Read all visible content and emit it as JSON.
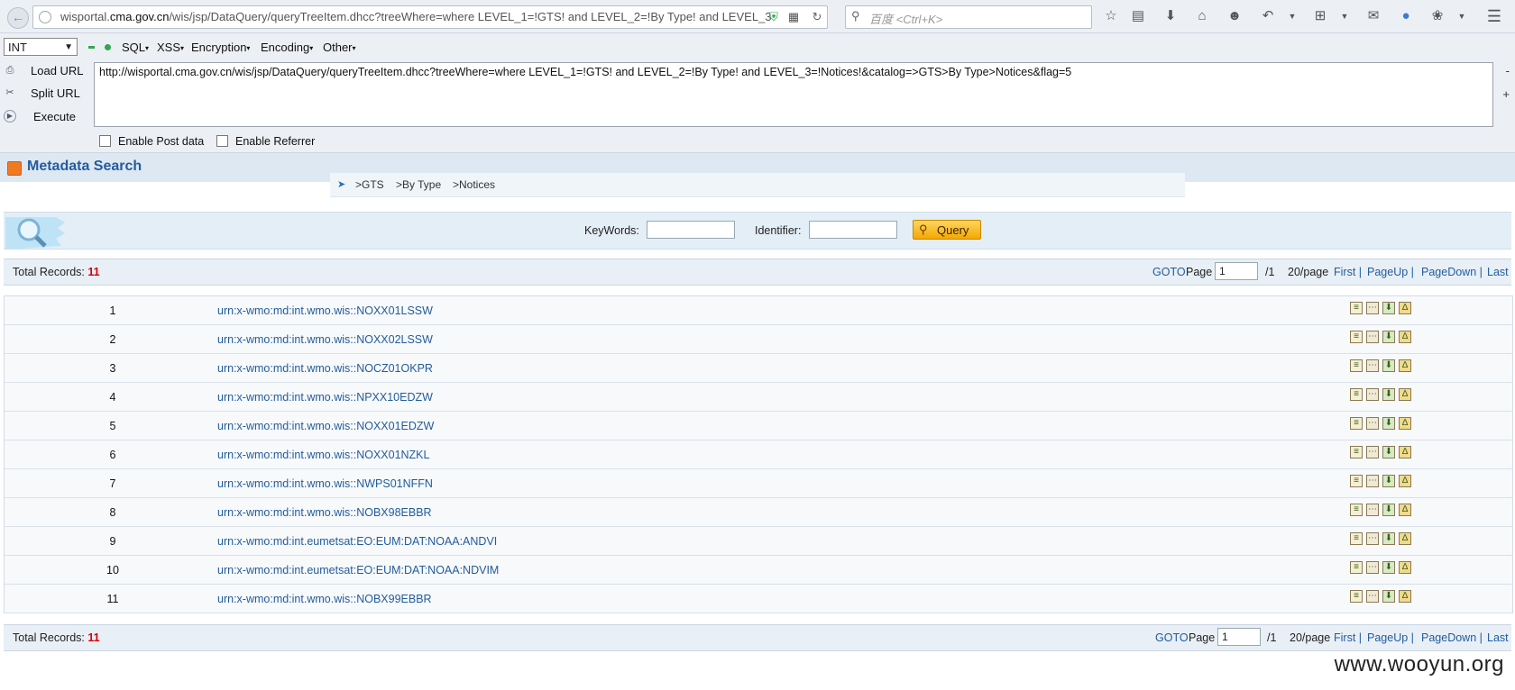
{
  "browser": {
    "url_host_prefix": "wisportal.",
    "url_host_main": "cma.gov.cn",
    "url_path": "/wis/jsp/DataQuery/queryTreeItem.dhcc?treeWhere=where LEVEL_1=!GTS! and LEVEL_2=!By Type! and LEVEL_3",
    "search_placeholder": "百度 <Ctrl+K>"
  },
  "hackbar": {
    "select_value": "INT",
    "menus": [
      "SQL",
      "XSS",
      "Encryption",
      "Encoding",
      "Other"
    ],
    "load_url": "Load URL",
    "split_url": "Split URL",
    "execute": "Execute",
    "url_text": "http://wisportal.cma.gov.cn/wis/jsp/DataQuery/queryTreeItem.dhcc?treeWhere=where LEVEL_1=!GTS! and LEVEL_2=!By Type! and LEVEL_3=!Notices!&catalog=>GTS>By Type>Notices&flag=5",
    "minus": "-",
    "plus": "+",
    "enable_post": "Enable Post data",
    "enable_referrer": "Enable Referrer"
  },
  "page": {
    "title": "Metadata Search",
    "breadcrumb": [
      ">GTS",
      ">By Type",
      ">Notices"
    ],
    "keywords_label": "KeyWords:",
    "identifier_label": "Identifier:",
    "query_label": "Query",
    "pager": {
      "total_label": "Total Records: ",
      "total": "11",
      "goto": "GOTO",
      "page_label": "Page",
      "page_value": "1",
      "of_pages": "/1",
      "per_page": "20/page",
      "first": "First",
      "pageup": "PageUp",
      "pagedown": "PageDown",
      "last": "Last",
      "sep": "|"
    },
    "rows": [
      {
        "num": "1",
        "urn": "urn:x-wmo:md:int.wmo.wis::NOXX01LSSW"
      },
      {
        "num": "2",
        "urn": "urn:x-wmo:md:int.wmo.wis::NOXX02LSSW"
      },
      {
        "num": "3",
        "urn": "urn:x-wmo:md:int.wmo.wis::NOCZ01OKPR"
      },
      {
        "num": "4",
        "urn": "urn:x-wmo:md:int.wmo.wis::NPXX10EDZW"
      },
      {
        "num": "5",
        "urn": "urn:x-wmo:md:int.wmo.wis::NOXX01EDZW"
      },
      {
        "num": "6",
        "urn": "urn:x-wmo:md:int.wmo.wis::NOXX01NZKL"
      },
      {
        "num": "7",
        "urn": "urn:x-wmo:md:int.wmo.wis::NWPS01NFFN"
      },
      {
        "num": "8",
        "urn": "urn:x-wmo:md:int.wmo.wis::NOBX98EBBR"
      },
      {
        "num": "9",
        "urn": "urn:x-wmo:md:int.eumetsat:EO:EUM:DAT:NOAA:ANDVI"
      },
      {
        "num": "10",
        "urn": "urn:x-wmo:md:int.eumetsat:EO:EUM:DAT:NOAA:NDVIM"
      },
      {
        "num": "11",
        "urn": "urn:x-wmo:md:int.wmo.wis::NOBX99EBBR"
      }
    ]
  },
  "watermark": "www.wooyun.org"
}
